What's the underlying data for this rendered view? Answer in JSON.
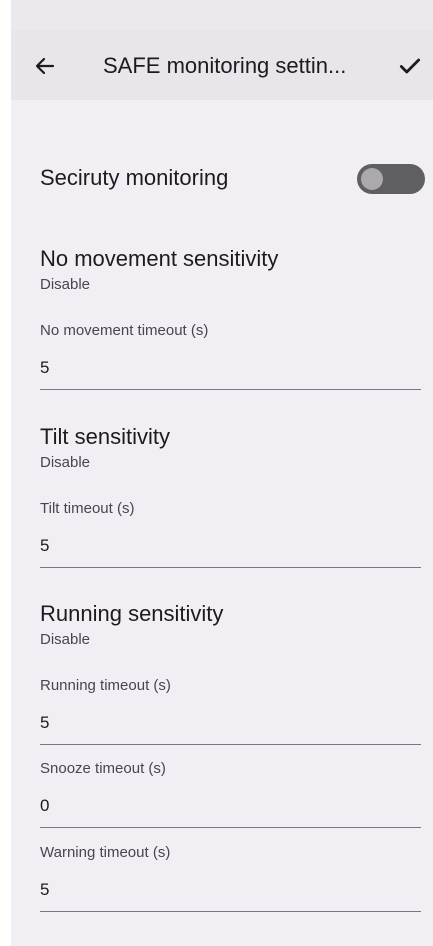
{
  "app_bar": {
    "title": "SAFE monitoring settin...",
    "back_icon": "arrow-left-icon",
    "done_icon": "check-icon"
  },
  "security_monitoring": {
    "label": "Seciruty monitoring",
    "enabled": false
  },
  "no_movement": {
    "title": "No movement sensitivity",
    "summary": "Disable",
    "timeout_label": "No movement timeout (s)",
    "timeout_value": "5"
  },
  "tilt": {
    "title": "Tilt sensitivity",
    "summary": "Disable",
    "timeout_label": "Tilt timeout (s)",
    "timeout_value": "5"
  },
  "running": {
    "title": "Running sensitivity",
    "summary": "Disable",
    "timeout_label": "Running timeout (s)",
    "timeout_value": "5"
  },
  "snooze": {
    "label": "Snooze timeout (s)",
    "value": "0"
  },
  "warning": {
    "label": "Warning timeout (s)",
    "value": "5"
  },
  "colors": {
    "background": "#f2eff4",
    "app_bar": "#e8e6ea",
    "switch_track_off": "#5f5e62",
    "switch_thumb_off": "#aba8ae"
  }
}
